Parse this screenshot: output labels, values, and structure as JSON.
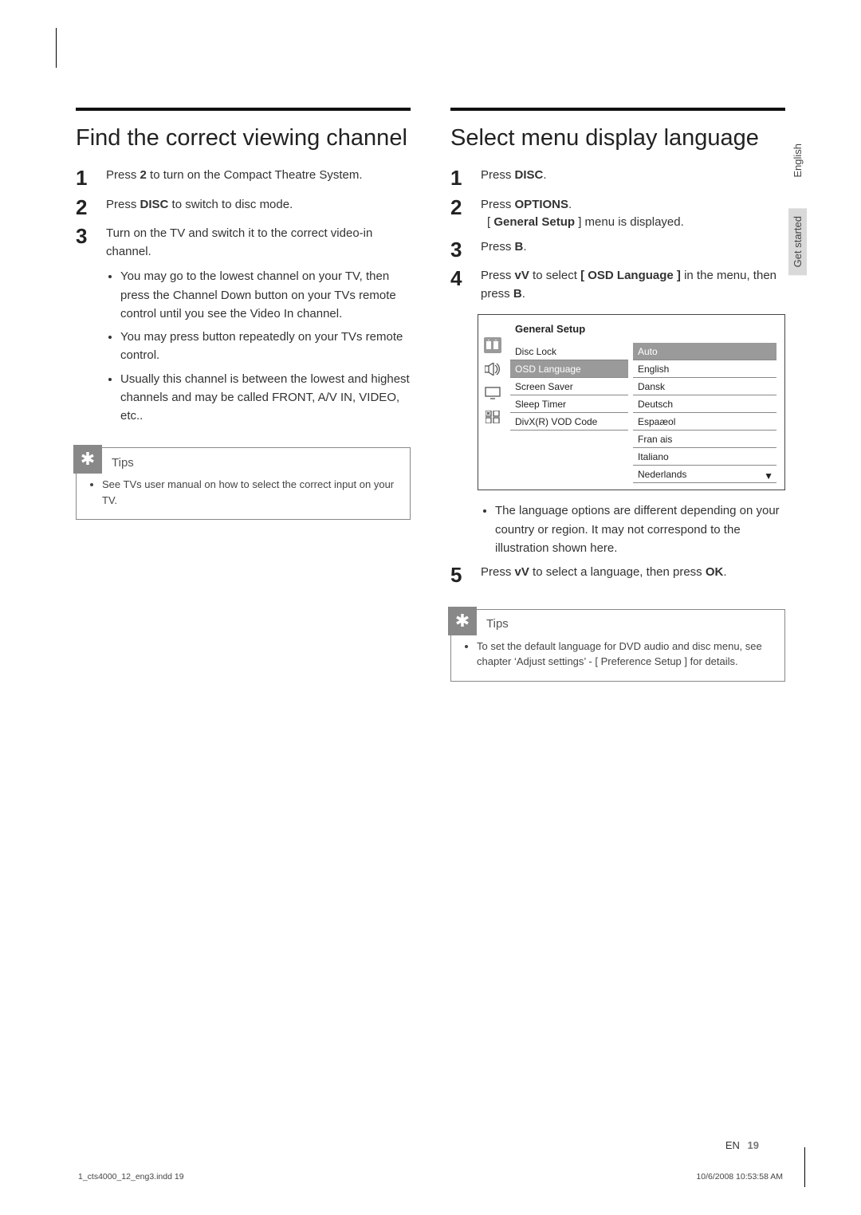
{
  "left": {
    "heading": "Find the correct viewing channel",
    "steps": [
      {
        "num": "1",
        "pre": "Press ",
        "bold1": "2",
        "mid": " to turn on the Compact Theatre System."
      },
      {
        "num": "2",
        "pre": "Press ",
        "bold1": "DISC",
        "mid": " to switch to disc mode."
      },
      {
        "num": "3",
        "pre": "Turn on the TV and switch it to the correct video-in channel."
      }
    ],
    "bullets": [
      "You may go to the lowest channel on your TV, then press the Channel Down button on your TVs remote control until you see the Video In channel.",
      "You may press        button repeatedly on your TVs remote control.",
      "Usually this channel is between the lowest and highest channels and may be called FRONT, A/V IN, VIDEO, etc.."
    ],
    "tips_title": "Tips",
    "tips_items": [
      "See TVs user manual on how to select the correct input on your TV."
    ]
  },
  "right": {
    "heading": "Select menu display language",
    "step1": {
      "num": "1",
      "pre": "Press ",
      "bold": "DISC",
      "post": "."
    },
    "step2": {
      "num": "2",
      "pre": "Press ",
      "bold": "OPTIONS",
      "post": ".",
      "sub_pre": "[ ",
      "sub_bold": "General Setup",
      "sub_post": " ] menu is displayed."
    },
    "step3": {
      "num": "3",
      "pre": "Press ",
      "bold": "B",
      "post": "."
    },
    "step4": {
      "num": "4",
      "pre": "Press ",
      "bold1": "vV",
      "mid": " to select ",
      "bold2": "[ OSD Language ]",
      "post": " in the menu, then press ",
      "bold3": "B",
      "tail": "."
    },
    "osd": {
      "title": "General Setup",
      "colA": [
        "Disc Lock",
        "OSD Language",
        "Screen Saver",
        "Sleep Timer",
        "DivX(R) VOD Code"
      ],
      "selectedA": 1,
      "colB": [
        "Auto",
        "English",
        "Dansk",
        "Deutsch",
        "Espaæol",
        "Fran ais",
        "Italiano",
        "Nederlands"
      ],
      "selectedB": 0
    },
    "post_bullets": [
      "The language options are different depending on your country or region. It may not correspond to the illustration shown here."
    ],
    "step5": {
      "num": "5",
      "pre": "Press ",
      "bold1": "vV",
      "mid": " to select a language, then press ",
      "bold2": "OK",
      "post": "."
    },
    "tips_title": "Tips",
    "tips_item_pre": "To set the default language for DVD audio and disc menu, see chapter ‘Adjust settings’ - ",
    "tips_item_bold": "[ Preference Setup ]",
    "tips_item_post": " for details."
  },
  "side_tabs": [
    "English",
    "Get started"
  ],
  "footer": {
    "lang": "EN",
    "page": "19"
  },
  "ind": {
    "left": "1_cts4000_12_eng3.indd   19",
    "right": "10/6/2008   10:53:58 AM"
  }
}
